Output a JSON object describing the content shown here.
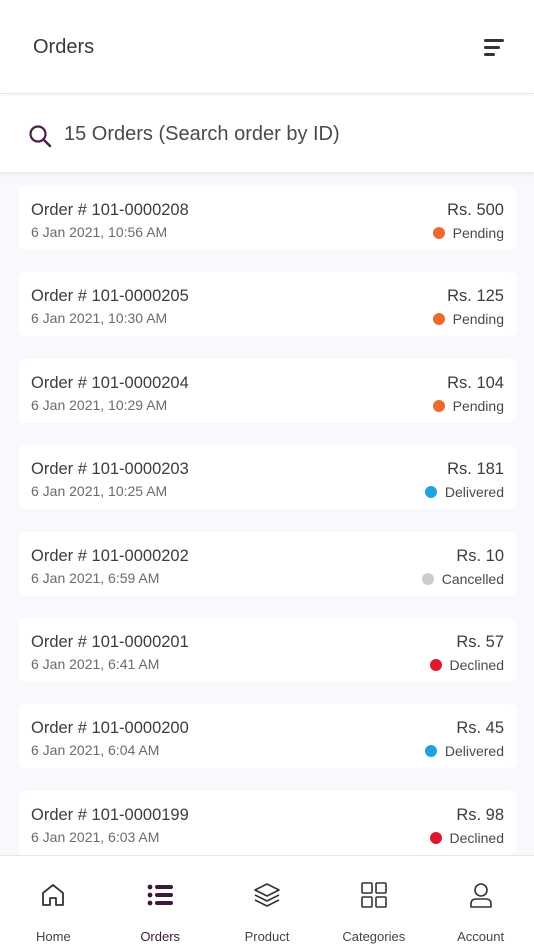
{
  "header": {
    "title": "Orders",
    "filter_icon": "filter-sort-icon"
  },
  "search": {
    "placeholder": "15 Orders (Search order by ID)",
    "icon": "search-icon"
  },
  "colors": {
    "accent": "#4a1d47",
    "pending": "#f0682b",
    "delivered": "#1fa3e0",
    "cancelled": "#cccccc",
    "declined": "#e0172f"
  },
  "orders": [
    {
      "id": "Order # 101-0000208",
      "date": "6 Jan 2021, 10:56 AM",
      "amount": "Rs. 500",
      "status": "Pending"
    },
    {
      "id": "Order # 101-0000205",
      "date": "6 Jan 2021, 10:30 AM",
      "amount": "Rs. 125",
      "status": "Pending"
    },
    {
      "id": "Order # 101-0000204",
      "date": "6 Jan 2021, 10:29 AM",
      "amount": "Rs. 104",
      "status": "Pending"
    },
    {
      "id": "Order # 101-0000203",
      "date": "6 Jan 2021, 10:25 AM",
      "amount": "Rs. 181",
      "status": "Delivered"
    },
    {
      "id": "Order # 101-0000202",
      "date": "6 Jan 2021, 6:59 AM",
      "amount": "Rs. 10",
      "status": "Cancelled"
    },
    {
      "id": "Order # 101-0000201",
      "date": "6 Jan 2021, 6:41 AM",
      "amount": "Rs. 57",
      "status": "Declined"
    },
    {
      "id": "Order # 101-0000200",
      "date": "6 Jan 2021, 6:04 AM",
      "amount": "Rs. 45",
      "status": "Delivered"
    },
    {
      "id": "Order # 101-0000199",
      "date": "6 Jan 2021, 6:03 AM",
      "amount": "Rs. 98",
      "status": "Declined"
    }
  ],
  "nav": {
    "items": [
      {
        "label": "Home",
        "icon": "home-icon"
      },
      {
        "label": "Orders",
        "icon": "orders-list-icon",
        "active": true
      },
      {
        "label": "Product",
        "icon": "layers-icon"
      },
      {
        "label": "Categories",
        "icon": "grid-icon"
      },
      {
        "label": "Account",
        "icon": "user-icon"
      }
    ]
  }
}
